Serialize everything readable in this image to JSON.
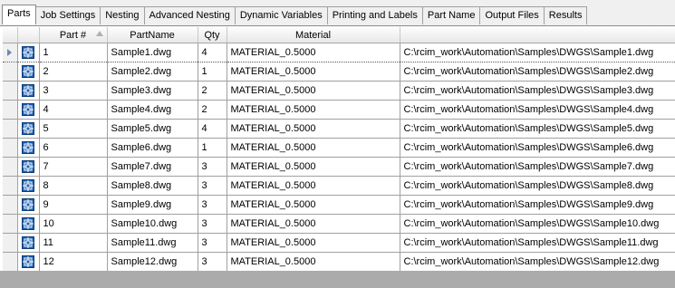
{
  "tabs": [
    {
      "label": "Parts",
      "active": true
    },
    {
      "label": "Job Settings"
    },
    {
      "label": "Nesting"
    },
    {
      "label": "Advanced Nesting"
    },
    {
      "label": "Dynamic Variables"
    },
    {
      "label": "Printing and Labels"
    },
    {
      "label": "Part Name"
    },
    {
      "label": "Output Files"
    },
    {
      "label": "Results"
    }
  ],
  "grid": {
    "columns": [
      "Part #",
      "PartName",
      "Qty",
      "Material",
      ""
    ],
    "rows": [
      {
        "num": "1",
        "name": "Sample1.dwg",
        "qty": "4",
        "material": "MATERIAL_0.5000",
        "path": "C:\\rcim_work\\Automation\\Samples\\DWGS\\Sample1.dwg"
      },
      {
        "num": "2",
        "name": "Sample2.dwg",
        "qty": "1",
        "material": "MATERIAL_0.5000",
        "path": "C:\\rcim_work\\Automation\\Samples\\DWGS\\Sample2.dwg"
      },
      {
        "num": "3",
        "name": "Sample3.dwg",
        "qty": "2",
        "material": "MATERIAL_0.5000",
        "path": "C:\\rcim_work\\Automation\\Samples\\DWGS\\Sample3.dwg"
      },
      {
        "num": "4",
        "name": "Sample4.dwg",
        "qty": "2",
        "material": "MATERIAL_0.5000",
        "path": "C:\\rcim_work\\Automation\\Samples\\DWGS\\Sample4.dwg"
      },
      {
        "num": "5",
        "name": "Sample5.dwg",
        "qty": "4",
        "material": "MATERIAL_0.5000",
        "path": "C:\\rcim_work\\Automation\\Samples\\DWGS\\Sample5.dwg"
      },
      {
        "num": "6",
        "name": "Sample6.dwg",
        "qty": "1",
        "material": "MATERIAL_0.5000",
        "path": "C:\\rcim_work\\Automation\\Samples\\DWGS\\Sample6.dwg"
      },
      {
        "num": "7",
        "name": "Sample7.dwg",
        "qty": "3",
        "material": "MATERIAL_0.5000",
        "path": "C:\\rcim_work\\Automation\\Samples\\DWGS\\Sample7.dwg"
      },
      {
        "num": "8",
        "name": "Sample8.dwg",
        "qty": "3",
        "material": "MATERIAL_0.5000",
        "path": "C:\\rcim_work\\Automation\\Samples\\DWGS\\Sample8.dwg"
      },
      {
        "num": "9",
        "name": "Sample9.dwg",
        "qty": "3",
        "material": "MATERIAL_0.5000",
        "path": "C:\\rcim_work\\Automation\\Samples\\DWGS\\Sample9.dwg"
      },
      {
        "num": "10",
        "name": "Sample10.dwg",
        "qty": "3",
        "material": "MATERIAL_0.5000",
        "path": "C:\\rcim_work\\Automation\\Samples\\DWGS\\Sample10.dwg"
      },
      {
        "num": "11",
        "name": "Sample11.dwg",
        "qty": "3",
        "material": "MATERIAL_0.5000",
        "path": "C:\\rcim_work\\Automation\\Samples\\DWGS\\Sample11.dwg"
      },
      {
        "num": "12",
        "name": "Sample12.dwg",
        "qty": "3",
        "material": "MATERIAL_0.5000",
        "path": "C:\\rcim_work\\Automation\\Samples\\DWGS\\Sample12.dwg"
      }
    ],
    "row_icon": "part-drawing-icon",
    "current_row_indicator": "row-pointer-icon",
    "sort_icon": "sort-ascending-icon"
  },
  "colors": {
    "icon_blue": "#1a5fb4",
    "header_gradient_end": "#e8e8e8",
    "bottom_bar": "#ababab"
  }
}
